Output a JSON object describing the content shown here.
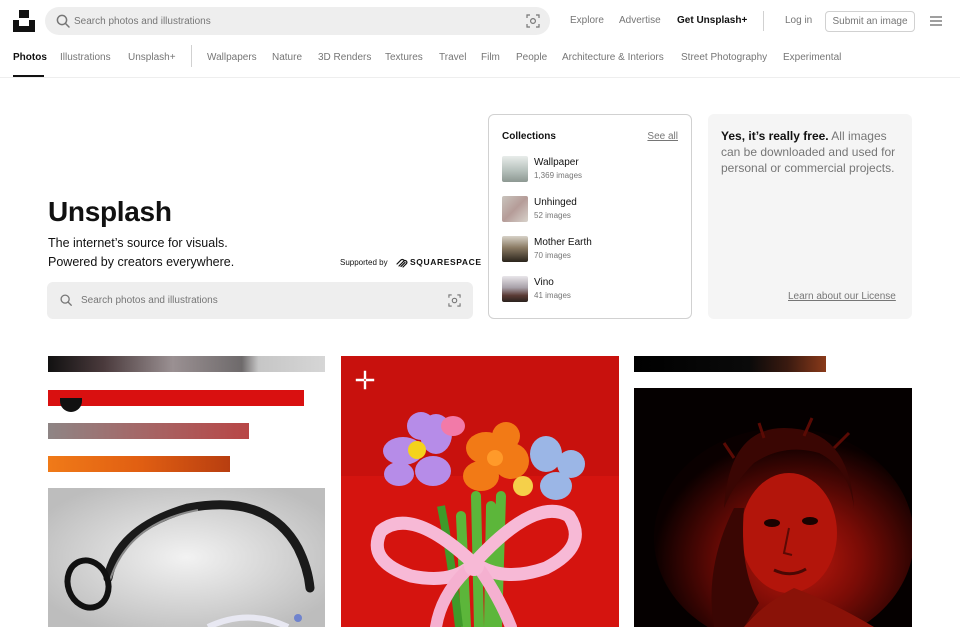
{
  "header": {
    "search_placeholder": "Search photos and illustrations",
    "nav": {
      "explore": "Explore",
      "advertise": "Advertise",
      "get_plus": "Get Unsplash+"
    },
    "login": "Log in",
    "submit": "Submit an image",
    "icons": {
      "logo": "unsplash-logo",
      "search": "search-icon",
      "visual_search": "visual-search-icon",
      "menu": "hamburger-menu-icon"
    }
  },
  "tabs": {
    "primary": [
      "Photos",
      "Illustrations",
      "Unsplash+"
    ],
    "topics": [
      "Wallpapers",
      "Nature",
      "3D Renders",
      "Textures",
      "Travel",
      "Film",
      "People",
      "Architecture & Interiors",
      "Street Photography",
      "Experimental"
    ],
    "active": "Photos"
  },
  "hero": {
    "title": "Unsplash",
    "subtitle_line1": "The internet’s source for visuals.",
    "subtitle_line2": "Powered by creators everywhere.",
    "supported_by": "Supported by",
    "sponsor": "SQUARESPACE",
    "search_placeholder": "Search photos and illustrations"
  },
  "collections": {
    "title": "Collections",
    "see_all": "See all",
    "items": [
      {
        "name": "Wallpaper",
        "count": "1,369 images"
      },
      {
        "name": "Unhinged",
        "count": "52 images"
      },
      {
        "name": "Mother Earth",
        "count": "70 images"
      },
      {
        "name": "Vino",
        "count": "41 images"
      }
    ]
  },
  "free": {
    "headline": "Yes, it’s really free.",
    "body": " All images can be downloaded and used for personal or commercial projects.",
    "license_link": "Learn about our License"
  },
  "colors": {
    "text": "#111111",
    "muted": "#767676",
    "border": "#d1d1d1",
    "search_bg": "#eeeeee",
    "card_bg": "#f5f5f5"
  }
}
